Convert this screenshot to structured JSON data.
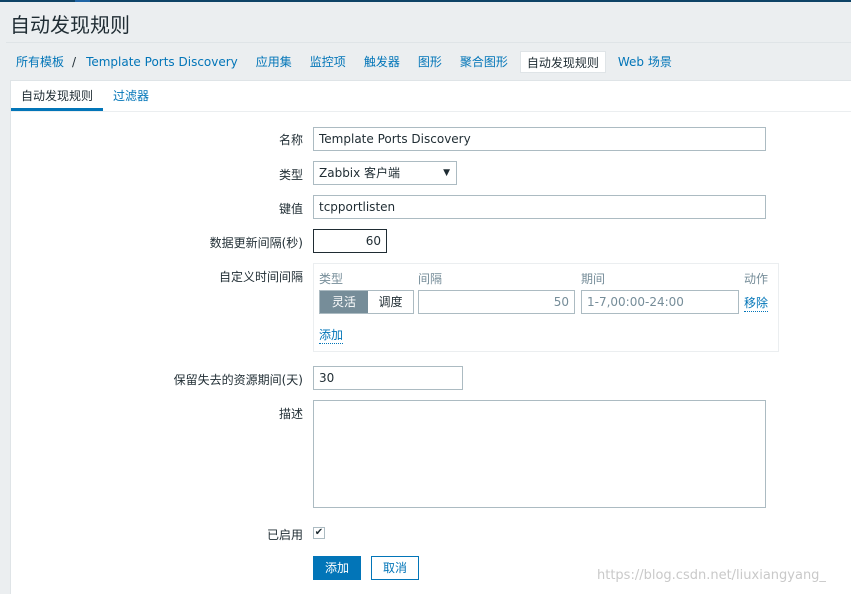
{
  "page": {
    "title": "自动发现规则"
  },
  "breadcrumb": {
    "root": "所有模板",
    "separator": "/",
    "template": "Template Ports Discovery"
  },
  "nav": [
    "应用集",
    "监控项",
    "触发器",
    "图形",
    "聚合图形",
    "自动发现规则",
    "Web 场景"
  ],
  "tabs": [
    "自动发现规则",
    "过滤器"
  ],
  "form": {
    "name_label": "名称",
    "name_value": "Template Ports Discovery",
    "type_label": "类型",
    "type_value": "Zabbix 客户端",
    "key_label": "键值",
    "key_value": "tcpportlisten",
    "interval_label": "数据更新间隔(秒)",
    "interval_value": "60",
    "custom_label": "自定义时间间隔",
    "custom": {
      "h_type": "类型",
      "h_interval": "间隔",
      "h_period": "期间",
      "h_action": "动作",
      "flex": "灵活",
      "sched": "调度",
      "interval": "50",
      "period": "1-7,00:00-24:00",
      "remove": "移除",
      "add": "添加"
    },
    "keep_label": "保留失去的资源期间(天)",
    "keep_value": "30",
    "desc_label": "描述",
    "desc_value": "",
    "enabled_label": "已启用",
    "enabled": true,
    "add_button": "添加",
    "cancel_button": "取消"
  },
  "watermark": "https://blog.csdn.net/liuxiangyang_"
}
